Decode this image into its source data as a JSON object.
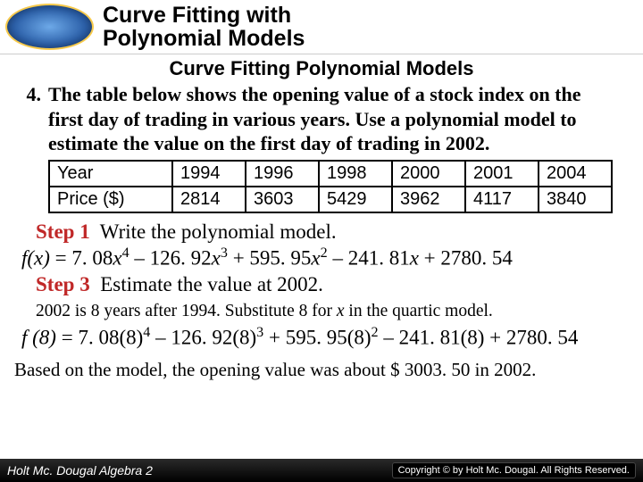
{
  "header": {
    "title_line1": "Curve Fitting with",
    "title_line2": "Polynomial Models"
  },
  "subtitle": "Curve Fitting Polynomial Models",
  "problem": {
    "number": "4.",
    "text": "The table below shows the opening value of a stock index on the first day of trading in various years. Use a polynomial model to estimate the value on the first day of trading in 2002."
  },
  "table": {
    "row1_label": "Year",
    "row2_label": "Price ($)",
    "years": [
      "1994",
      "1996",
      "1998",
      "2000",
      "2001",
      "2004"
    ],
    "prices": [
      "2814",
      "3603",
      "5429",
      "3962",
      "4117",
      "3840"
    ]
  },
  "step1": {
    "label": "Step 1",
    "text": "Write the polynomial model."
  },
  "equation1": {
    "lhs": "f(x)",
    "c4": "7. 08",
    "c3": "126. 92",
    "c2": "595. 95",
    "c1": "241. 81",
    "c0": "2780. 54"
  },
  "step3": {
    "label": "Step 3",
    "text": "Estimate the value at 2002."
  },
  "sub_note": "2002 is 8 years after 1994. Substitute 8 for x in the quartic model.",
  "equation2": {
    "lhs": "f (8)",
    "c4": "7. 08(8)",
    "c3": "126. 92(8)",
    "c2": "595. 95(8)",
    "c1": "241. 81(8)",
    "c0": "2780. 54"
  },
  "conclusion": "Based on the model, the opening value was about $ 3003. 50 in 2002.",
  "footer": {
    "left": "Holt Mc. Dougal Algebra 2",
    "right": "Copyright © by Holt Mc. Dougal. All Rights Reserved."
  },
  "chart_data": {
    "type": "table",
    "columns": [
      "Year",
      "Price ($)"
    ],
    "rows": [
      [
        1994,
        2814
      ],
      [
        1996,
        3603
      ],
      [
        1998,
        5429
      ],
      [
        2000,
        3962
      ],
      [
        2001,
        4117
      ],
      [
        2004,
        3840
      ]
    ],
    "model": {
      "degree": 4,
      "coefficients": [
        7.08,
        -126.92,
        595.95,
        -241.81,
        2780.54
      ],
      "x_meaning": "years since 1994"
    },
    "prediction": {
      "year": 2002,
      "x": 8,
      "value": 3003.5
    }
  }
}
